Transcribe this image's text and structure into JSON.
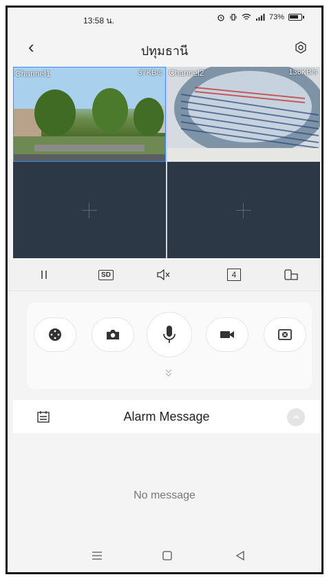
{
  "status_bar": {
    "time": "13:58 น.",
    "battery": "73%"
  },
  "header": {
    "title": "ปทุมธานี"
  },
  "channels": [
    {
      "label": "Channel1",
      "rate": "37KB/s"
    },
    {
      "label": "Channel2",
      "rate": "136KB/s"
    }
  ],
  "toolbar": {
    "quality": "SD",
    "split": "4"
  },
  "alarm": {
    "title": "Alarm Message",
    "empty_text": "No message"
  },
  "colors": {
    "selected_border": "#3a8cff",
    "video_bg": "#2c3845"
  }
}
